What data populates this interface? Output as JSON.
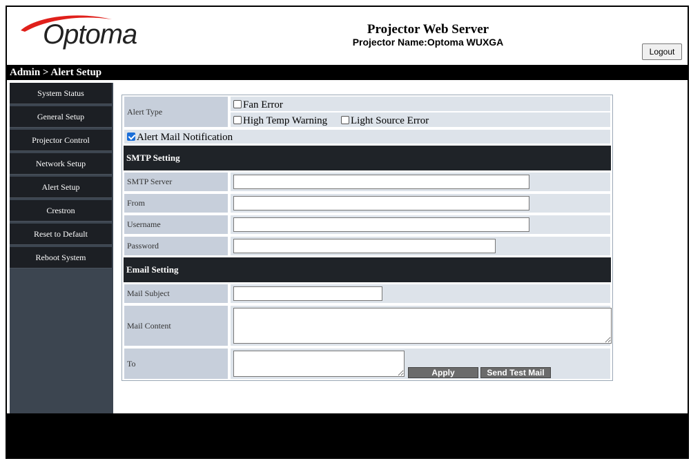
{
  "header": {
    "logo_text": "Optoma",
    "title": "Projector Web Server",
    "projector_name": "Projector Name:Optoma WUXGA",
    "logout_label": "Logout"
  },
  "breadcrumb": "Admin > Alert Setup",
  "sidebar": {
    "items": [
      {
        "label": "System Status"
      },
      {
        "label": "General Setup"
      },
      {
        "label": "Projector Control"
      },
      {
        "label": "Network Setup"
      },
      {
        "label": "Alert Setup"
      },
      {
        "label": "Crestron"
      },
      {
        "label": "Reset to Default"
      },
      {
        "label": "Reboot System"
      }
    ]
  },
  "form": {
    "alert_type_label": "Alert Type",
    "fan_error": {
      "label": "Fan Error",
      "checked": false
    },
    "high_temp": {
      "label": "High Temp Warning",
      "checked": false
    },
    "light_source": {
      "label": "Light Source Error",
      "checked": false
    },
    "alert_mail": {
      "label": "Alert Mail Notification",
      "checked": true
    },
    "smtp_section": "SMTP Setting",
    "smtp_server_label": "SMTP Server",
    "smtp_server_value": "",
    "from_label": "From",
    "from_value": "",
    "username_label": "Username",
    "username_value": "",
    "password_label": "Password",
    "password_value": "",
    "email_section": "Email Setting",
    "mail_subject_label": "Mail Subject",
    "mail_subject_value": "",
    "mail_content_label": "Mail Content",
    "mail_content_value": "",
    "to_label": "To",
    "to_value": "",
    "apply_label": "Apply",
    "send_test_label": "Send Test Mail"
  },
  "colors": {
    "logo_red": "#e0201b",
    "sidebar_bg": "#3c4550",
    "sidebar_item": "#1c1f24",
    "label_bg": "#c7cfdb",
    "value_bg": "#dde3ea",
    "checkbox_checked": "#1a6ed8"
  }
}
